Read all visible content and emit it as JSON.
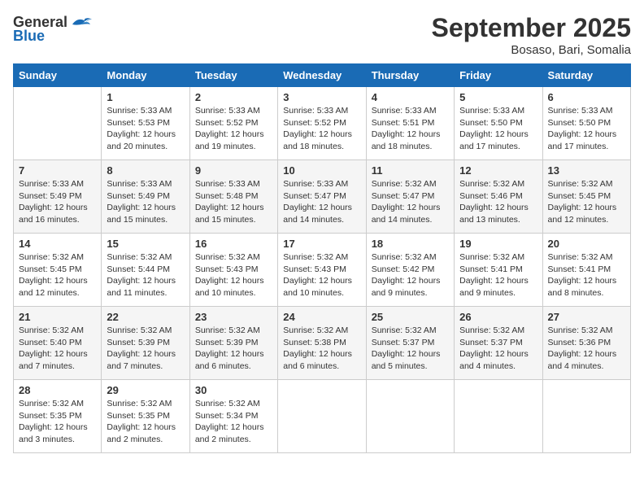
{
  "logo": {
    "text_general": "General",
    "text_blue": "Blue"
  },
  "title": "September 2025",
  "location": "Bosaso, Bari, Somalia",
  "headers": [
    "Sunday",
    "Monday",
    "Tuesday",
    "Wednesday",
    "Thursday",
    "Friday",
    "Saturday"
  ],
  "weeks": [
    [
      {
        "day": "",
        "info": ""
      },
      {
        "day": "1",
        "info": "Sunrise: 5:33 AM\nSunset: 5:53 PM\nDaylight: 12 hours\nand 20 minutes."
      },
      {
        "day": "2",
        "info": "Sunrise: 5:33 AM\nSunset: 5:52 PM\nDaylight: 12 hours\nand 19 minutes."
      },
      {
        "day": "3",
        "info": "Sunrise: 5:33 AM\nSunset: 5:52 PM\nDaylight: 12 hours\nand 18 minutes."
      },
      {
        "day": "4",
        "info": "Sunrise: 5:33 AM\nSunset: 5:51 PM\nDaylight: 12 hours\nand 18 minutes."
      },
      {
        "day": "5",
        "info": "Sunrise: 5:33 AM\nSunset: 5:50 PM\nDaylight: 12 hours\nand 17 minutes."
      },
      {
        "day": "6",
        "info": "Sunrise: 5:33 AM\nSunset: 5:50 PM\nDaylight: 12 hours\nand 17 minutes."
      }
    ],
    [
      {
        "day": "7",
        "info": "Sunrise: 5:33 AM\nSunset: 5:49 PM\nDaylight: 12 hours\nand 16 minutes."
      },
      {
        "day": "8",
        "info": "Sunrise: 5:33 AM\nSunset: 5:49 PM\nDaylight: 12 hours\nand 15 minutes."
      },
      {
        "day": "9",
        "info": "Sunrise: 5:33 AM\nSunset: 5:48 PM\nDaylight: 12 hours\nand 15 minutes."
      },
      {
        "day": "10",
        "info": "Sunrise: 5:33 AM\nSunset: 5:47 PM\nDaylight: 12 hours\nand 14 minutes."
      },
      {
        "day": "11",
        "info": "Sunrise: 5:32 AM\nSunset: 5:47 PM\nDaylight: 12 hours\nand 14 minutes."
      },
      {
        "day": "12",
        "info": "Sunrise: 5:32 AM\nSunset: 5:46 PM\nDaylight: 12 hours\nand 13 minutes."
      },
      {
        "day": "13",
        "info": "Sunrise: 5:32 AM\nSunset: 5:45 PM\nDaylight: 12 hours\nand 12 minutes."
      }
    ],
    [
      {
        "day": "14",
        "info": "Sunrise: 5:32 AM\nSunset: 5:45 PM\nDaylight: 12 hours\nand 12 minutes."
      },
      {
        "day": "15",
        "info": "Sunrise: 5:32 AM\nSunset: 5:44 PM\nDaylight: 12 hours\nand 11 minutes."
      },
      {
        "day": "16",
        "info": "Sunrise: 5:32 AM\nSunset: 5:43 PM\nDaylight: 12 hours\nand 10 minutes."
      },
      {
        "day": "17",
        "info": "Sunrise: 5:32 AM\nSunset: 5:43 PM\nDaylight: 12 hours\nand 10 minutes."
      },
      {
        "day": "18",
        "info": "Sunrise: 5:32 AM\nSunset: 5:42 PM\nDaylight: 12 hours\nand 9 minutes."
      },
      {
        "day": "19",
        "info": "Sunrise: 5:32 AM\nSunset: 5:41 PM\nDaylight: 12 hours\nand 9 minutes."
      },
      {
        "day": "20",
        "info": "Sunrise: 5:32 AM\nSunset: 5:41 PM\nDaylight: 12 hours\nand 8 minutes."
      }
    ],
    [
      {
        "day": "21",
        "info": "Sunrise: 5:32 AM\nSunset: 5:40 PM\nDaylight: 12 hours\nand 7 minutes."
      },
      {
        "day": "22",
        "info": "Sunrise: 5:32 AM\nSunset: 5:39 PM\nDaylight: 12 hours\nand 7 minutes."
      },
      {
        "day": "23",
        "info": "Sunrise: 5:32 AM\nSunset: 5:39 PM\nDaylight: 12 hours\nand 6 minutes."
      },
      {
        "day": "24",
        "info": "Sunrise: 5:32 AM\nSunset: 5:38 PM\nDaylight: 12 hours\nand 6 minutes."
      },
      {
        "day": "25",
        "info": "Sunrise: 5:32 AM\nSunset: 5:37 PM\nDaylight: 12 hours\nand 5 minutes."
      },
      {
        "day": "26",
        "info": "Sunrise: 5:32 AM\nSunset: 5:37 PM\nDaylight: 12 hours\nand 4 minutes."
      },
      {
        "day": "27",
        "info": "Sunrise: 5:32 AM\nSunset: 5:36 PM\nDaylight: 12 hours\nand 4 minutes."
      }
    ],
    [
      {
        "day": "28",
        "info": "Sunrise: 5:32 AM\nSunset: 5:35 PM\nDaylight: 12 hours\nand 3 minutes."
      },
      {
        "day": "29",
        "info": "Sunrise: 5:32 AM\nSunset: 5:35 PM\nDaylight: 12 hours\nand 2 minutes."
      },
      {
        "day": "30",
        "info": "Sunrise: 5:32 AM\nSunset: 5:34 PM\nDaylight: 12 hours\nand 2 minutes."
      },
      {
        "day": "",
        "info": ""
      },
      {
        "day": "",
        "info": ""
      },
      {
        "day": "",
        "info": ""
      },
      {
        "day": "",
        "info": ""
      }
    ]
  ]
}
